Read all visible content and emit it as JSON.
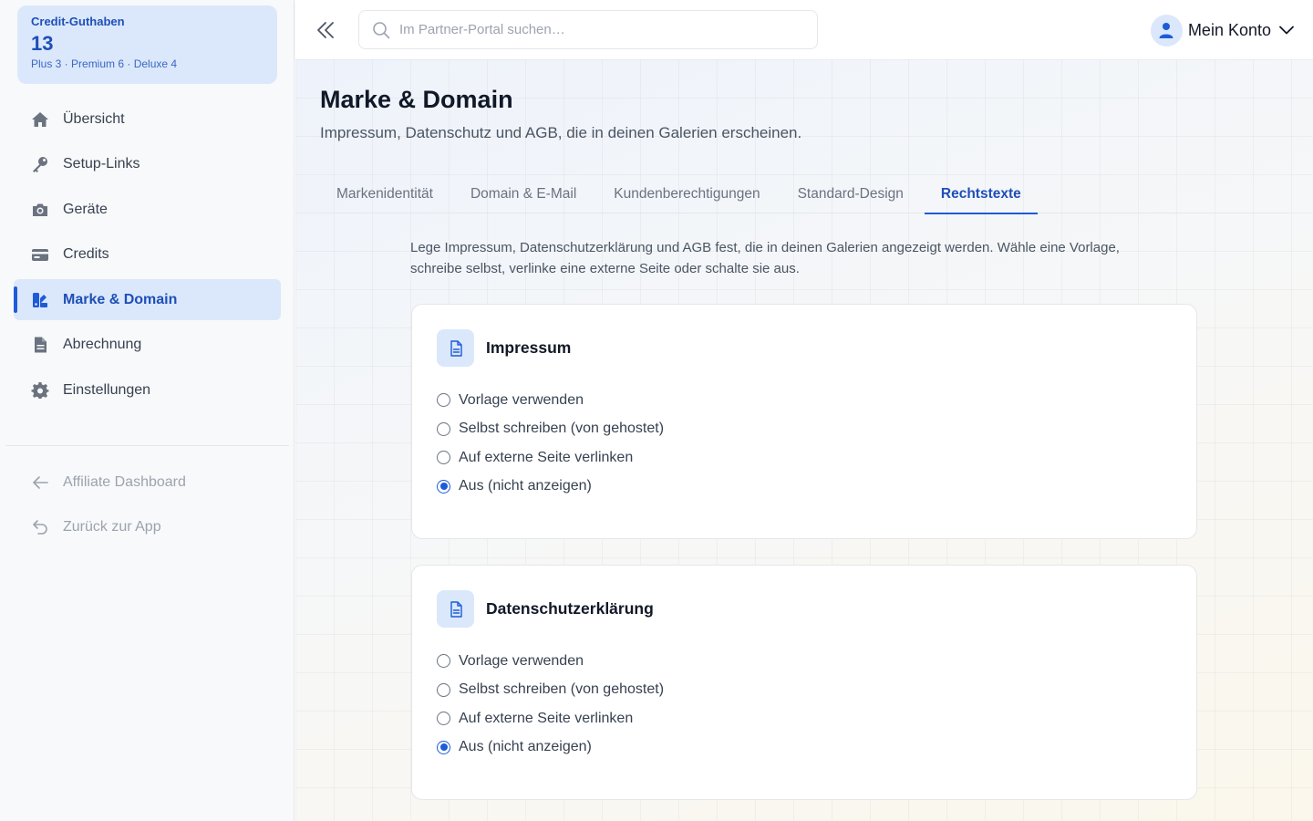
{
  "credits": {
    "title": "Credit-Guthaben",
    "count": "13",
    "breakdown": "Plus 3 · Premium 6 · Deluxe 4"
  },
  "sidebar": {
    "items": [
      {
        "label": "Übersicht",
        "icon": "home-icon"
      },
      {
        "label": "Setup-Links",
        "icon": "key-icon"
      },
      {
        "label": "Geräte",
        "icon": "camera-icon"
      },
      {
        "label": "Credits",
        "icon": "credit-card-icon"
      },
      {
        "label": "Marke & Domain",
        "icon": "brand-icon",
        "active": true
      },
      {
        "label": "Abrechnung",
        "icon": "invoice-icon"
      },
      {
        "label": "Einstellungen",
        "icon": "gear-icon"
      }
    ],
    "secondary": [
      {
        "label": "Affiliate Dashboard",
        "icon": "arrow-left-icon"
      },
      {
        "label": "Zurück zur App",
        "icon": "return-icon"
      }
    ]
  },
  "header": {
    "search_placeholder": "Im Partner-Portal suchen…",
    "account_label": "Mein Konto"
  },
  "page": {
    "title": "Marke & Domain",
    "subtitle": "Impressum, Datenschutz und AGB, die in deinen Galerien erscheinen.",
    "tabs": [
      {
        "label": "Markenidentität"
      },
      {
        "label": "Domain & E-Mail"
      },
      {
        "label": "Kundenberechtigungen"
      },
      {
        "label": "Standard-Design"
      },
      {
        "label": "Rechtstexte",
        "active": true
      }
    ],
    "intro": "Lege Impressum, Datenschutzerklärung und AGB fest, die in deinen Galerien angezeigt werden. Wähle eine Vorlage, schreibe selbst, verlinke eine externe Seite oder schalte sie aus.",
    "cards": [
      {
        "title": "Impressum",
        "options": [
          "Vorlage verwenden",
          "Selbst schreiben (von gehostet)",
          "Auf externe Seite verlinken",
          "Aus (nicht anzeigen)"
        ],
        "selected": "Aus (nicht anzeigen)"
      },
      {
        "title": "Datenschutzerklärung",
        "options": [
          "Vorlage verwenden",
          "Selbst schreiben (von gehostet)",
          "Auf externe Seite verlinken",
          "Aus (nicht anzeigen)"
        ],
        "selected": "Aus (nicht anzeigen)"
      }
    ]
  },
  "colors": {
    "accent": "#1e5bd8",
    "accent_light": "#dbe8fb"
  }
}
